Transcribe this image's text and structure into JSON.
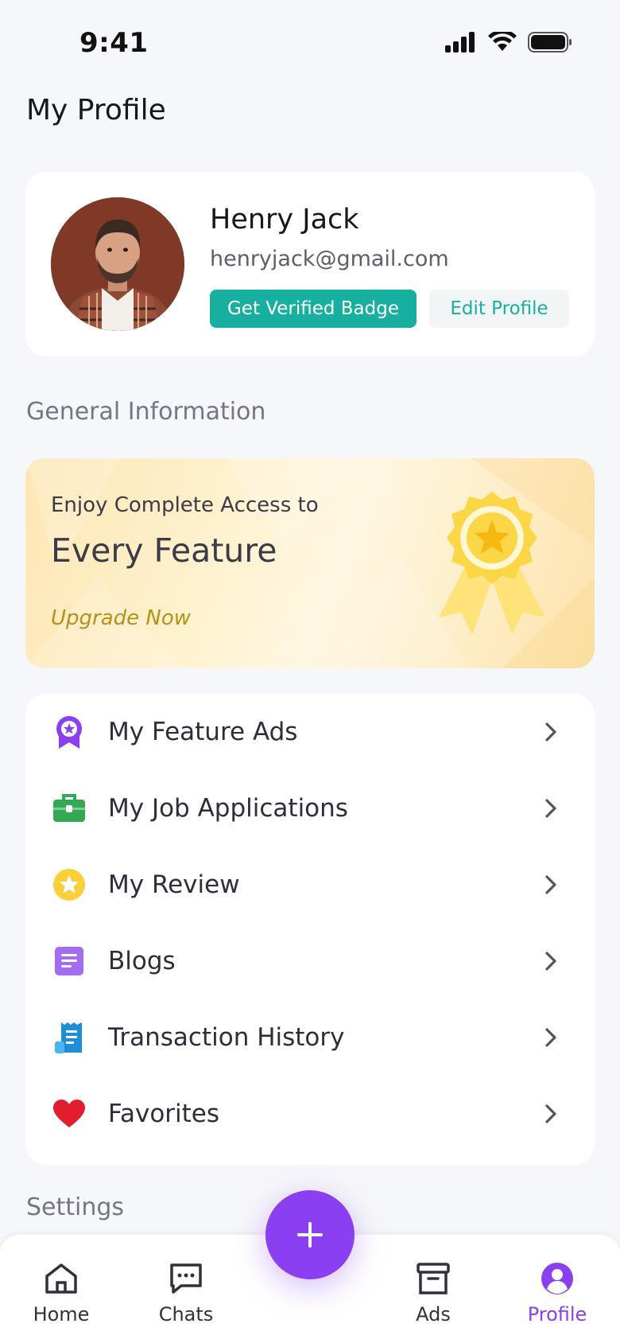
{
  "status_bar": {
    "time": "9:41"
  },
  "header": {
    "title": "My Profile"
  },
  "profile": {
    "name": "Henry Jack",
    "email": "henryjack@gmail.com",
    "verified_button": "Get Verified Badge",
    "edit_button": "Edit Profile"
  },
  "sections": {
    "general": "General Information",
    "settings": "Settings"
  },
  "promo": {
    "line1": "Enjoy Complete Access to",
    "line2": "Every Feature",
    "cta": "Upgrade Now"
  },
  "menu": {
    "items": [
      {
        "label": "My Feature Ads",
        "icon": "award-ribbon-icon"
      },
      {
        "label": "My Job Applications",
        "icon": "briefcase-icon"
      },
      {
        "label": "My Review",
        "icon": "star-icon"
      },
      {
        "label": "Blogs",
        "icon": "document-icon"
      },
      {
        "label": "Transaction History",
        "icon": "receipt-icon"
      },
      {
        "label": "Favorites",
        "icon": "heart-icon"
      }
    ]
  },
  "tabbar": {
    "home": "Home",
    "chats": "Chats",
    "ads": "Ads",
    "profile": "Profile",
    "active": "profile"
  },
  "colors": {
    "accent": "#8a3ff0",
    "teal": "#17b0a0",
    "gold": "#b59215"
  }
}
